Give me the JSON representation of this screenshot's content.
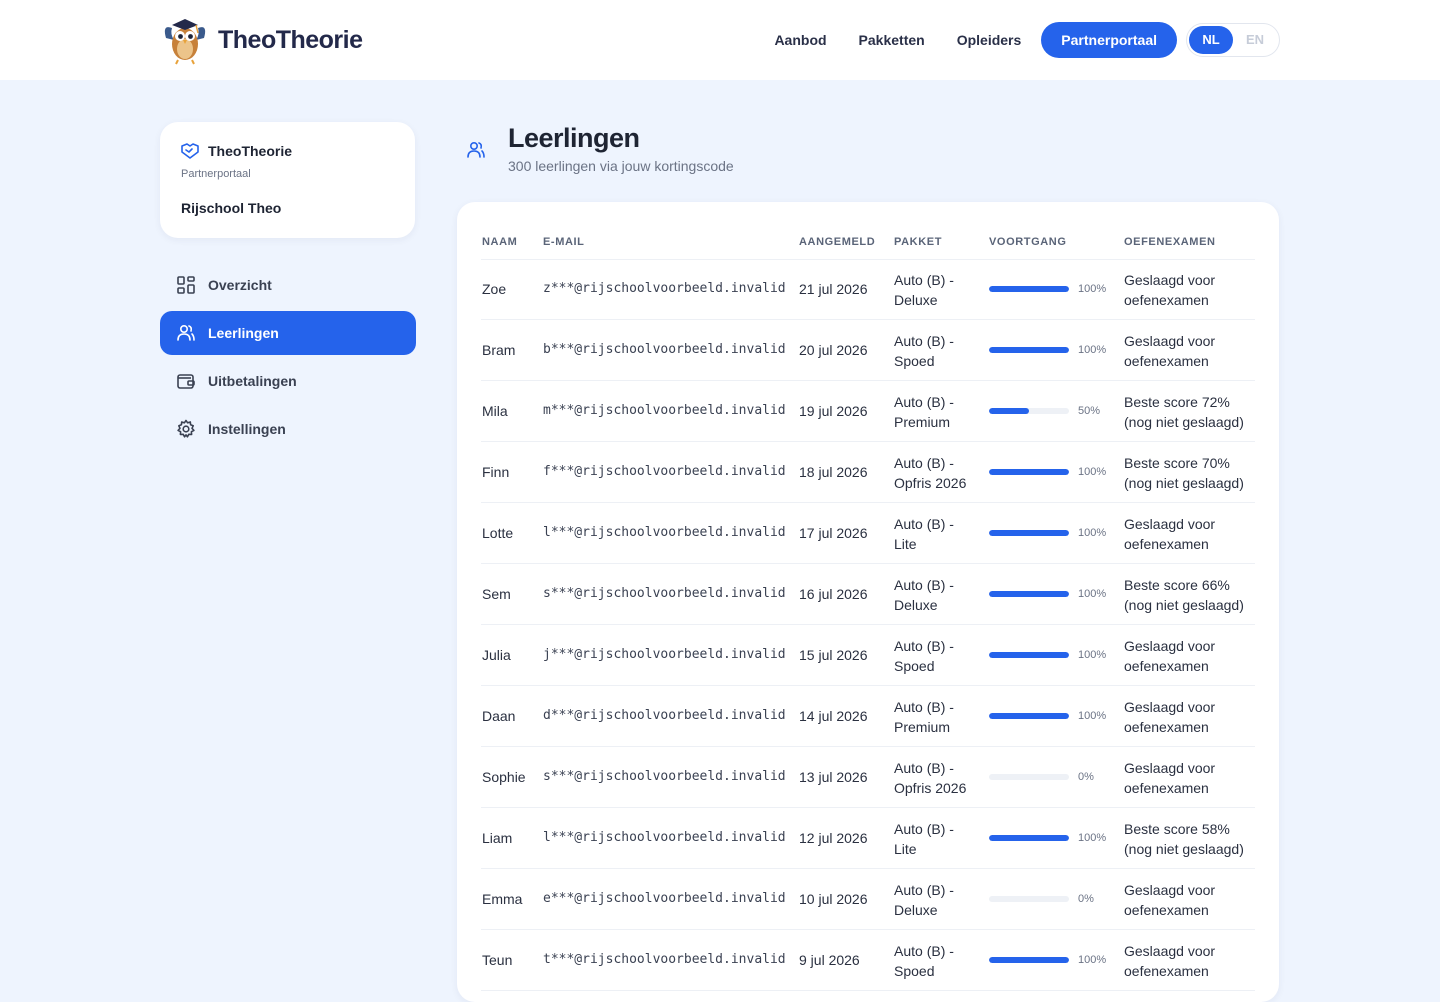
{
  "header": {
    "brand": "TheoTheorie",
    "nav": [
      "Aanbod",
      "Pakketten",
      "Opleiders"
    ],
    "cta": "Partnerportaal",
    "lang_active": "NL",
    "lang_inactive": "EN"
  },
  "profile": {
    "brand": "TheoTheorie",
    "subtitle": "Partnerportaal",
    "school": "Rijschool Theo"
  },
  "sidebar": {
    "items": [
      {
        "label": "Overzicht",
        "icon": "grid-icon",
        "active": false
      },
      {
        "label": "Leerlingen",
        "icon": "users-icon",
        "active": true
      },
      {
        "label": "Uitbetalingen",
        "icon": "wallet-icon",
        "active": false
      },
      {
        "label": "Instellingen",
        "icon": "gear-icon",
        "active": false
      }
    ]
  },
  "main": {
    "title": "Leerlingen",
    "subtitle": "300 leerlingen via jouw kortingscode"
  },
  "table": {
    "headers": [
      "NAAM",
      "E-MAIL",
      "AANGEMELD",
      "PAKKET",
      "VOORTGANG",
      "OEFENEXAMEN"
    ],
    "rows": [
      {
        "name": "Zoe",
        "email": "z***@rijschoolvoorbeeld.invalid",
        "date": "21 jul 2026",
        "pkg1": "Auto (B) -",
        "pkg2": "Deluxe",
        "progress": 100,
        "progress_label": "100%",
        "exam1": "Geslaagd voor",
        "exam2": "oefenexamen"
      },
      {
        "name": "Bram",
        "email": "b***@rijschoolvoorbeeld.invalid",
        "date": "20 jul 2026",
        "pkg1": "Auto (B) -",
        "pkg2": "Spoed",
        "progress": 100,
        "progress_label": "100%",
        "exam1": "Geslaagd voor",
        "exam2": "oefenexamen"
      },
      {
        "name": "Mila",
        "email": "m***@rijschoolvoorbeeld.invalid",
        "date": "19 jul 2026",
        "pkg1": "Auto (B) -",
        "pkg2": "Premium",
        "progress": 50,
        "progress_label": "50%",
        "exam1": "Beste score 72%",
        "exam2": "(nog niet geslaagd)"
      },
      {
        "name": "Finn",
        "email": "f***@rijschoolvoorbeeld.invalid",
        "date": "18 jul 2026",
        "pkg1": "Auto (B) -",
        "pkg2": "Opfris 2026",
        "progress": 100,
        "progress_label": "100%",
        "exam1": "Beste score 70%",
        "exam2": "(nog niet geslaagd)"
      },
      {
        "name": "Lotte",
        "email": "l***@rijschoolvoorbeeld.invalid",
        "date": "17 jul 2026",
        "pkg1": "Auto (B) -",
        "pkg2": "Lite",
        "progress": 100,
        "progress_label": "100%",
        "exam1": "Geslaagd voor",
        "exam2": "oefenexamen"
      },
      {
        "name": "Sem",
        "email": "s***@rijschoolvoorbeeld.invalid",
        "date": "16 jul 2026",
        "pkg1": "Auto (B) -",
        "pkg2": "Deluxe",
        "progress": 100,
        "progress_label": "100%",
        "exam1": "Beste score 66%",
        "exam2": "(nog niet geslaagd)"
      },
      {
        "name": "Julia",
        "email": "j***@rijschoolvoorbeeld.invalid",
        "date": "15 jul 2026",
        "pkg1": "Auto (B) -",
        "pkg2": "Spoed",
        "progress": 100,
        "progress_label": "100%",
        "exam1": "Geslaagd voor",
        "exam2": "oefenexamen"
      },
      {
        "name": "Daan",
        "email": "d***@rijschoolvoorbeeld.invalid",
        "date": "14 jul 2026",
        "pkg1": "Auto (B) -",
        "pkg2": "Premium",
        "progress": 100,
        "progress_label": "100%",
        "exam1": "Geslaagd voor",
        "exam2": "oefenexamen"
      },
      {
        "name": "Sophie",
        "email": "s***@rijschoolvoorbeeld.invalid",
        "date": "13 jul 2026",
        "pkg1": "Auto (B) -",
        "pkg2": "Opfris 2026",
        "progress": 0,
        "progress_label": "0%",
        "exam1": "Geslaagd voor",
        "exam2": "oefenexamen"
      },
      {
        "name": "Liam",
        "email": "l***@rijschoolvoorbeeld.invalid",
        "date": "12 jul 2026",
        "pkg1": "Auto (B) -",
        "pkg2": "Lite",
        "progress": 100,
        "progress_label": "100%",
        "exam1": "Beste score 58%",
        "exam2": "(nog niet geslaagd)"
      },
      {
        "name": "Emma",
        "email": "e***@rijschoolvoorbeeld.invalid",
        "date": "10 jul 2026",
        "pkg1": "Auto (B) -",
        "pkg2": "Deluxe",
        "progress": 0,
        "progress_label": "0%",
        "exam1": "Geslaagd voor",
        "exam2": "oefenexamen"
      },
      {
        "name": "Teun",
        "email": "t***@rijschoolvoorbeeld.invalid",
        "date": "9 jul 2026",
        "pkg1": "Auto (B) -",
        "pkg2": "Spoed",
        "progress": 100,
        "progress_label": "100%",
        "exam1": "Geslaagd voor",
        "exam2": "oefenexamen"
      }
    ]
  },
  "colors": {
    "accent": "#2563eb",
    "page_bg": "#eef4fe"
  }
}
